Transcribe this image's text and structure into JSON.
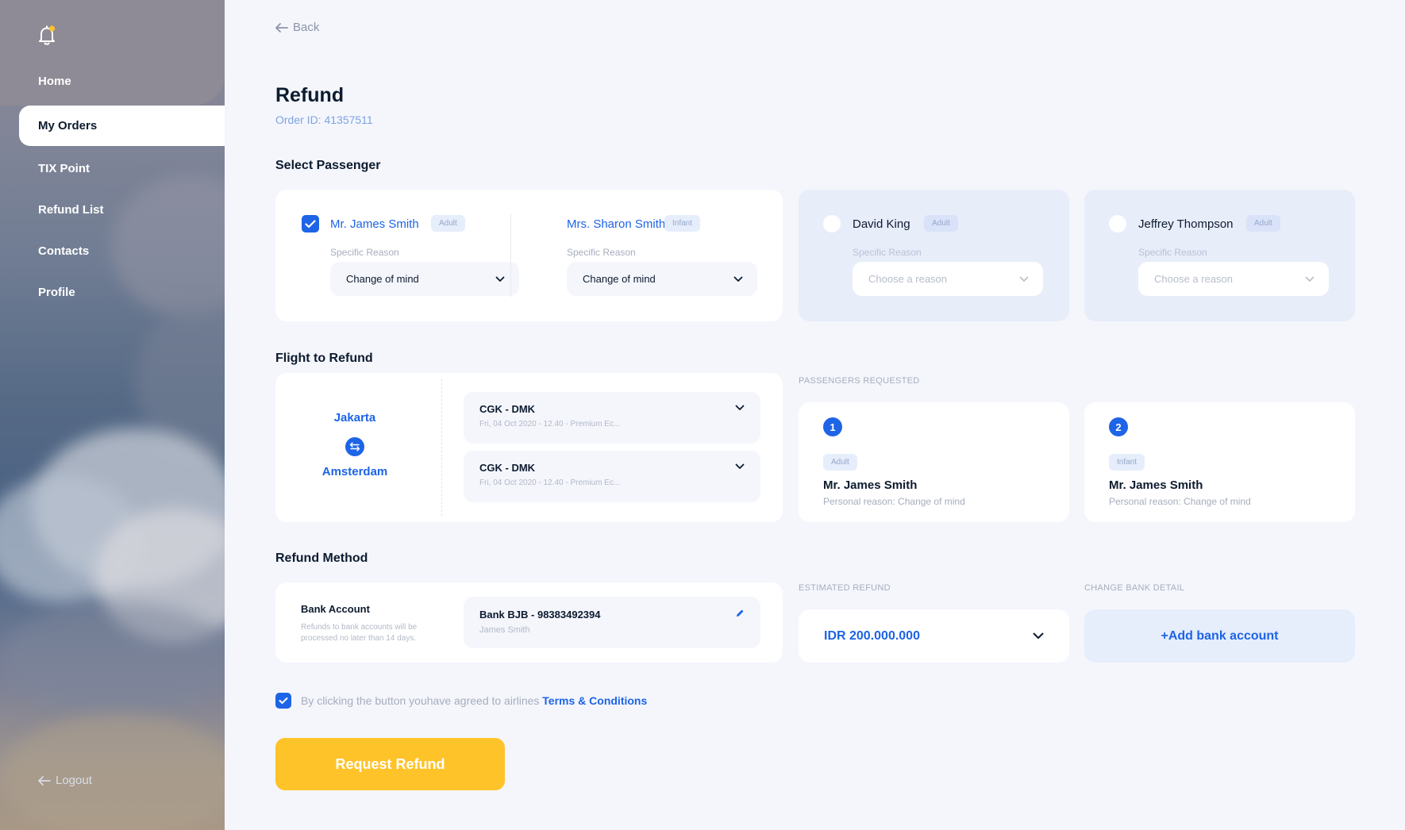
{
  "sidebar": {
    "items": [
      {
        "label": "Home"
      },
      {
        "label": "My Orders"
      },
      {
        "label": "TIX Point"
      },
      {
        "label": "Refund List"
      },
      {
        "label": "Contacts"
      },
      {
        "label": "Profile"
      }
    ],
    "logout": "Logout"
  },
  "header": {
    "back": "Back",
    "title": "Refund",
    "order_id": "Order ID: 41357511"
  },
  "select_passenger": {
    "title": "Select Passenger",
    "reason_label": "Specific Reason",
    "passengers": [
      {
        "name": "Mr. James Smith",
        "type": "Adult",
        "reason": "Change of mind"
      },
      {
        "name": "Mrs. Sharon Smith",
        "type": "Infant",
        "reason": "Change of mind"
      },
      {
        "name": "David King",
        "type": "Adult",
        "reason": "Choose a reason"
      },
      {
        "name": "Jeffrey Thompson",
        "type": "Adult",
        "reason": "Choose a reason"
      }
    ]
  },
  "flight": {
    "title": "Flight to Refund",
    "from": "Jakarta",
    "to": "Amsterdam",
    "options": [
      {
        "route": "CGK - DMK",
        "detail": "Fri, 04 Oct 2020 - 12.40 - Premium Ec..."
      },
      {
        "route": "CGK - DMK",
        "detail": "Fri, 04 Oct 2020 - 12.40 - Premium Ec..."
      }
    ]
  },
  "passengers_requested": {
    "title": "PASSENGERS REQUESTED",
    "items": [
      {
        "number": "1",
        "type": "Adult",
        "name": "Mr. James Smith",
        "reason": "Personal reason: Change of mind"
      },
      {
        "number": "2",
        "type": "Infant",
        "name": "Mr. James Smith",
        "reason": "Personal reason: Change of mind"
      }
    ]
  },
  "refund_method": {
    "title": "Refund Method",
    "method_name": "Bank Account",
    "method_note": "Refunds to bank accounts will be processed no later than 14 days.",
    "bank": "Bank BJB - 98383492394",
    "holder": "James Smith"
  },
  "estimated_refund": {
    "title": "ESTIMATED REFUND",
    "amount": "IDR 200.000.000"
  },
  "change_bank": {
    "title": "CHANGE BANK DETAIL",
    "add_label": "+Add bank account"
  },
  "agreement": {
    "text": "By clicking the button youhave agreed to airlines ",
    "link": "Terms & Conditions"
  },
  "cta": {
    "label": "Request Refund"
  },
  "colors": {
    "primary": "#1d64e6",
    "accent": "#ffc32a",
    "background": "#f4f6fc"
  }
}
